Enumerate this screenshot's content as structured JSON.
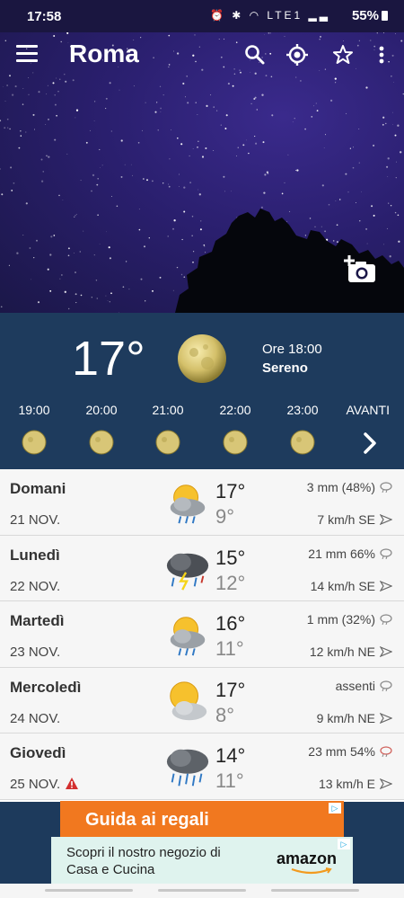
{
  "status": {
    "time": "17:58",
    "icons": "⏰ ✱ ◠ LTE1 ▂▃",
    "battery": "55%"
  },
  "app": {
    "city": "Roma"
  },
  "current": {
    "temp": "17°",
    "time_label": "Ore 18:00",
    "condition": "Sereno"
  },
  "hourly": [
    {
      "time": "19:00"
    },
    {
      "time": "20:00"
    },
    {
      "time": "21:00"
    },
    {
      "time": "22:00"
    },
    {
      "time": "23:00"
    }
  ],
  "hourly_next_label": "AVANTI",
  "forecast": [
    {
      "day": "Domani",
      "date": "21 NOV.",
      "icon": "sun-cloud-rain",
      "tmax": "17°",
      "tmin": "9°",
      "rain": "3 mm (48%)",
      "wind": "7 km/h SE",
      "alert": false
    },
    {
      "day": "Lunedì",
      "date": "22 NOV.",
      "icon": "thunderstorm",
      "tmax": "15°",
      "tmin": "12°",
      "rain": "21 mm 66%",
      "wind": "14 km/h SE",
      "alert": false
    },
    {
      "day": "Martedì",
      "date": "23 NOV.",
      "icon": "sun-cloud-rain",
      "tmax": "16°",
      "tmin": "11°",
      "rain": "1 mm (32%)",
      "wind": "12 km/h NE",
      "alert": false
    },
    {
      "day": "Mercoledì",
      "date": "24 NOV.",
      "icon": "sun-cloud",
      "tmax": "17°",
      "tmin": "8°",
      "rain": "assenti",
      "wind": "9 km/h NE",
      "alert": false
    },
    {
      "day": "Giovedì",
      "date": "25 NOV.",
      "icon": "heavy-rain",
      "tmax": "14°",
      "tmin": "11°",
      "rain": "23 mm 54%",
      "wind": "13 km/h E",
      "alert": true
    }
  ],
  "ads": {
    "banner1": "Guida ai regali",
    "banner2_text": "Scopri il nostro negozio di Casa e Cucina",
    "banner2_brand": "amazon"
  },
  "colors": {
    "panel": "#1e3b5d",
    "ad_orange": "#f1781f",
    "alert_red": "#d32f2f"
  }
}
